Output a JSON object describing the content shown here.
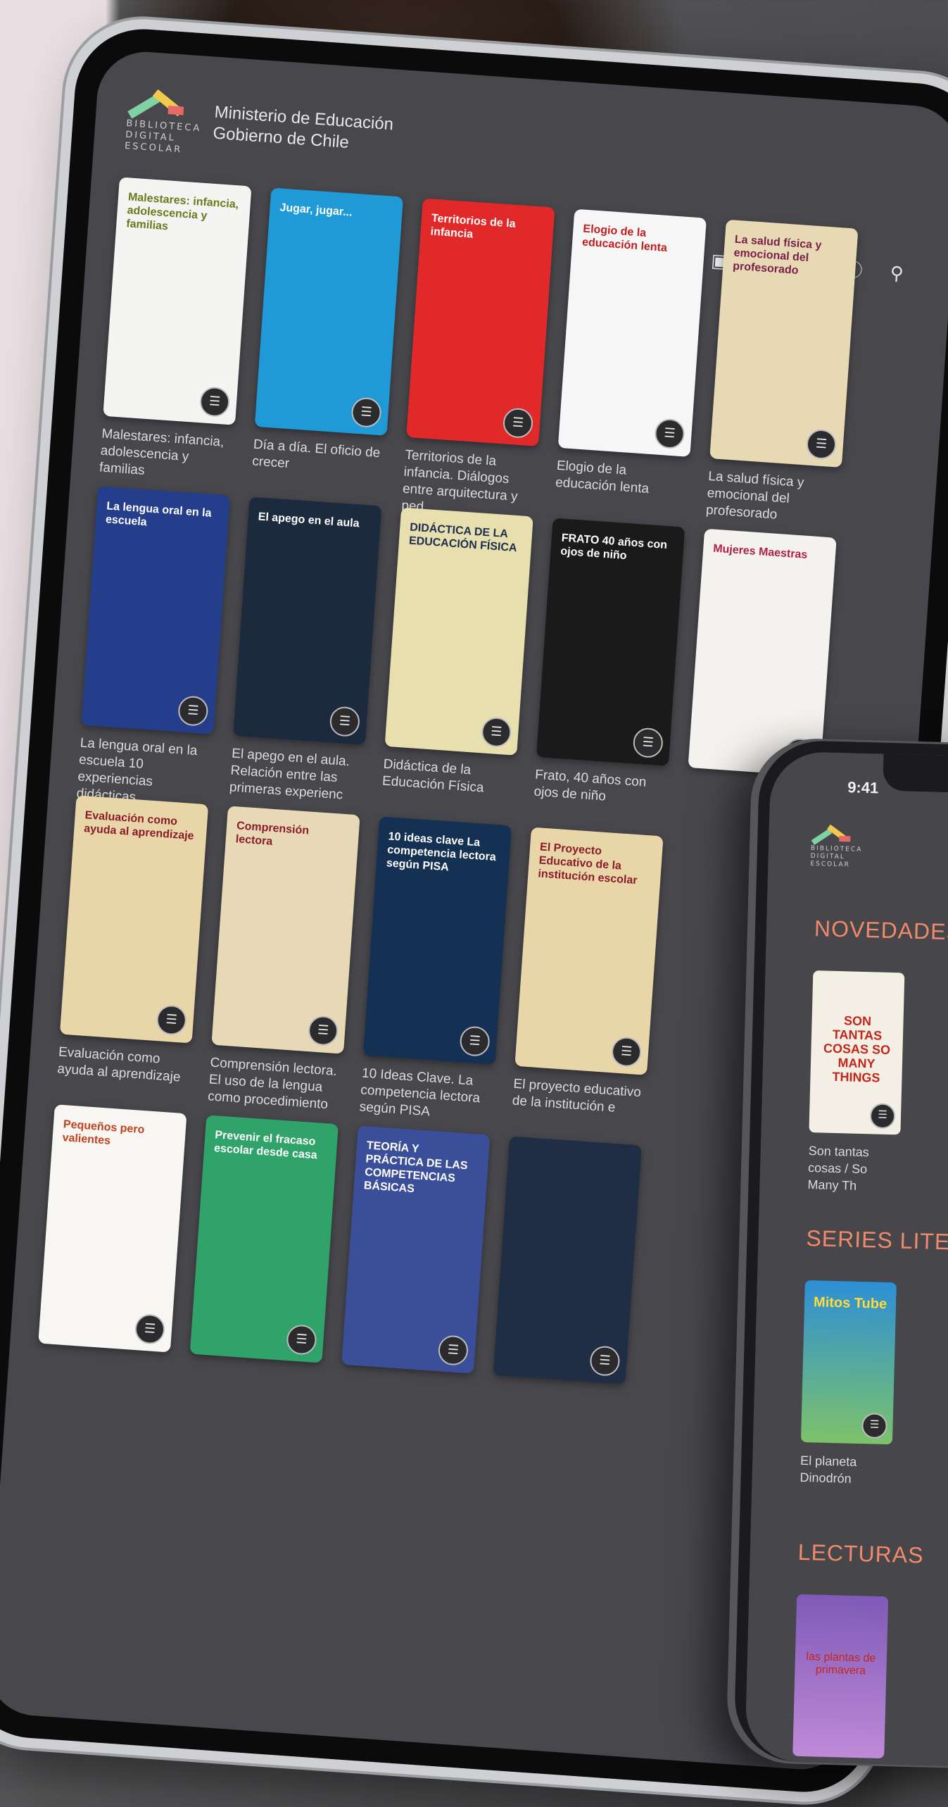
{
  "app": {
    "logo_text": "BIBLIOTECA\nDIGITAL\nESCOLAR",
    "ministry_line1": "Ministerio de Educación",
    "ministry_line2": "Gobierno de Chile"
  },
  "top_icons": [
    "home-icon",
    "bookmark-icon",
    "bell-icon",
    "avatar",
    "help-icon",
    "search-icon"
  ],
  "tablet_rows": [
    [
      {
        "cover_text": "Malestares: infancia, adolescencia y familias",
        "title": "Malestares: infancia, adolescencia y familias",
        "bg": "#f4f4f2",
        "fg": "#6b7a1a"
      },
      {
        "cover_text": "Jugar, jugar...",
        "title": "Día a día. El oficio de crecer",
        "bg": "#1f9ad6",
        "fg": "#ffffff"
      },
      {
        "cover_text": "Territorios de la infancia",
        "title": "Territorios de la infancia. Diálogos entre arquitectura y ped",
        "bg": "#e22929",
        "fg": "#ffffff"
      },
      {
        "cover_text": "Elogio de la educación lenta",
        "title": "Elogio de la educación lenta",
        "bg": "#f6f6f6",
        "fg": "#c21c1c"
      },
      {
        "cover_text": "La salud física y emocional del profesorado",
        "title": "La salud física y emocional del profesorado",
        "bg": "#e7d9b4",
        "fg": "#7a1e4a"
      }
    ],
    [
      {
        "cover_text": "La lengua oral en la escuela",
        "title": "La lengua oral en la escuela 10 experiencias didácticas",
        "bg": "#243e8c",
        "fg": "#ffffff"
      },
      {
        "cover_text": "El apego en el aula",
        "title": "El apego en el aula. Relación entre las primeras experienc",
        "bg": "#1c2a3e",
        "fg": "#ffffff"
      },
      {
        "cover_text": "DIDÁCTICA DE LA EDUCACIÓN FÍSICA",
        "title": "Didáctica de la Educación Física",
        "bg": "#e8dfae",
        "fg": "#1d2d4f"
      },
      {
        "cover_text": "FRATO 40 años con ojos de niño",
        "title": "Frato, 40 años con ojos de niño",
        "bg": "#1a1a1a",
        "fg": "#ffffff"
      },
      {
        "cover_text": "Mujeres Maestras",
        "title": "",
        "bg": "#f4f2ee",
        "fg": "#b0204c"
      }
    ],
    [
      {
        "cover_text": "Evaluación como ayuda al aprendizaje",
        "title": "Evaluación como ayuda al aprendizaje",
        "bg": "#e9d6a8",
        "fg": "#8a1c2a"
      },
      {
        "cover_text": "Comprensión lectora",
        "title": "Comprensión lectora. El uso de la lengua como procedimiento",
        "bg": "#e8d9b6",
        "fg": "#8a1c2a"
      },
      {
        "cover_text": "10 ideas clave La competencia lectora según PISA",
        "title": "10 Ideas Clave. La competencia lectora según PISA",
        "bg": "#143052",
        "fg": "#ffffff"
      },
      {
        "cover_text": "El Proyecto Educativo de la institución escolar",
        "title": "El proyecto educativo de la institución e",
        "bg": "#e9d6a8",
        "fg": "#8a1c2a"
      }
    ],
    [
      {
        "cover_text": "Pequeños pero valientes",
        "title": "",
        "bg": "#f8f6f2",
        "fg": "#c2401c"
      },
      {
        "cover_text": "Prevenir el fracaso escolar desde casa",
        "title": "",
        "bg": "#2fa36a",
        "fg": "#ffffff"
      },
      {
        "cover_text": "TEORÍA Y PRÁCTICA DE LAS COMPETENCIAS BÁSICAS",
        "title": "",
        "bg": "#3a4e9a",
        "fg": "#ffffff"
      },
      {
        "cover_text": "",
        "title": "",
        "bg": "#1f2e44",
        "fg": "#ffffff"
      }
    ]
  ],
  "phone": {
    "time": "9:41",
    "logo_text": "BIBLIOTECA\nDIGITAL\nESCOLAR",
    "section1": "NOVEDADES",
    "book1_cover": "SON TANTAS COSAS SO MANY THINGS",
    "book1_title": "Son tantas cosas / So Many Th",
    "section2": "SERIES LITERARIAS",
    "book2_cover": "Mitos Tube",
    "book2_title": "El planeta Dinodrón",
    "section3": "LECTURAS",
    "book3_cover": "las plantas de primavera"
  },
  "colors": {
    "accent": "#f08a6a",
    "screen": "#47474c"
  }
}
